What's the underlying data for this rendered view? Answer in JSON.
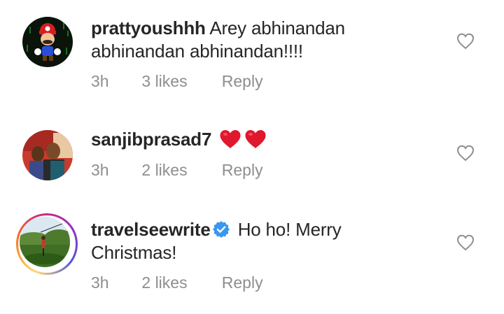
{
  "comments": [
    {
      "username": "prattyoushhh",
      "text": "Arey abhinandan abhinandan abhinandan!!!!",
      "time": "3h",
      "likes": "3 likes",
      "reply": "Reply"
    },
    {
      "username": "sanjibprasad7",
      "text": "",
      "emoji": [
        "red-heart",
        "red-heart"
      ],
      "time": "3h",
      "likes": "2 likes",
      "reply": "Reply"
    },
    {
      "username": "travelseewrite",
      "verified": true,
      "text": "Ho ho! Merry Christmas!",
      "time": "3h",
      "likes": "2 likes",
      "reply": "Reply"
    }
  ],
  "colors": {
    "text": "#262626",
    "meta": "#8e8e8e",
    "verified": "#3897f0",
    "heart_emoji": "#e0182d"
  },
  "icons": [
    "like-heart-outline-icon",
    "verified-badge-icon",
    "red-heart-emoji"
  ]
}
